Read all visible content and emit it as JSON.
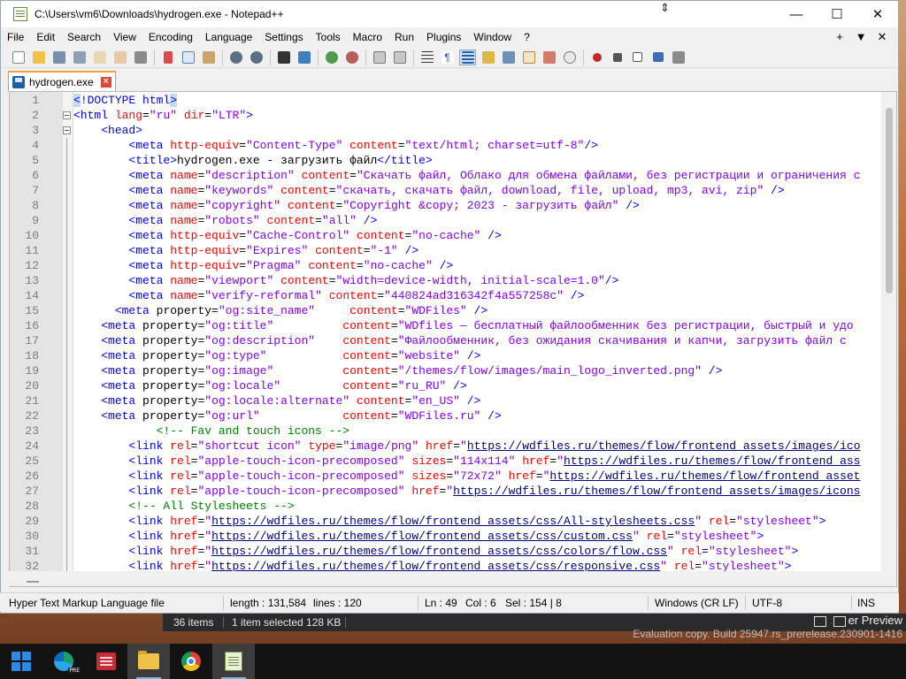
{
  "window": {
    "title": "C:\\Users\\vm6\\Downloads\\hydrogen.exe - Notepad++",
    "controls": [
      "—",
      "☐",
      "✕"
    ]
  },
  "menu": {
    "items": [
      "File",
      "Edit",
      "Search",
      "View",
      "Encoding",
      "Language",
      "Settings",
      "Tools",
      "Macro",
      "Run",
      "Plugins",
      "Window",
      "?"
    ],
    "right": [
      "+",
      "▼",
      "✕"
    ]
  },
  "tab": {
    "label": "hydrogen.exe",
    "close": "✕"
  },
  "editor": {
    "line_numbers": [
      "1",
      "2",
      "3",
      "4",
      "5",
      "6",
      "7",
      "8",
      "9",
      "10",
      "11",
      "12",
      "13",
      "14",
      "15",
      "16",
      "17",
      "18",
      "19",
      "20",
      "21",
      "22",
      "23",
      "24",
      "25",
      "26",
      "27",
      "28",
      "29",
      "30",
      "31",
      "32"
    ]
  },
  "statusbar": {
    "file_type": "Hyper Text Markup Language file",
    "length": "length : 131,584",
    "lines": "lines : 120",
    "ln": "Ln : 49",
    "col": "Col : 6",
    "sel": "Sel : 154 | 8",
    "eol": "Windows (CR LF)",
    "encoding": "UTF-8",
    "mode": "INS"
  },
  "explorer": {
    "items": "36 items",
    "selected": "1 item selected  128 KB",
    "preview_text": "er Preview",
    "eval_text": "Evaluation copy. Build 25947.rs_prerelease.230901-1416"
  },
  "colors": {
    "tag": "#0000ff",
    "attribute": "#ff0000",
    "value": "#8000ff",
    "comment": "#008000",
    "tab_accent": "#f2a43a"
  }
}
